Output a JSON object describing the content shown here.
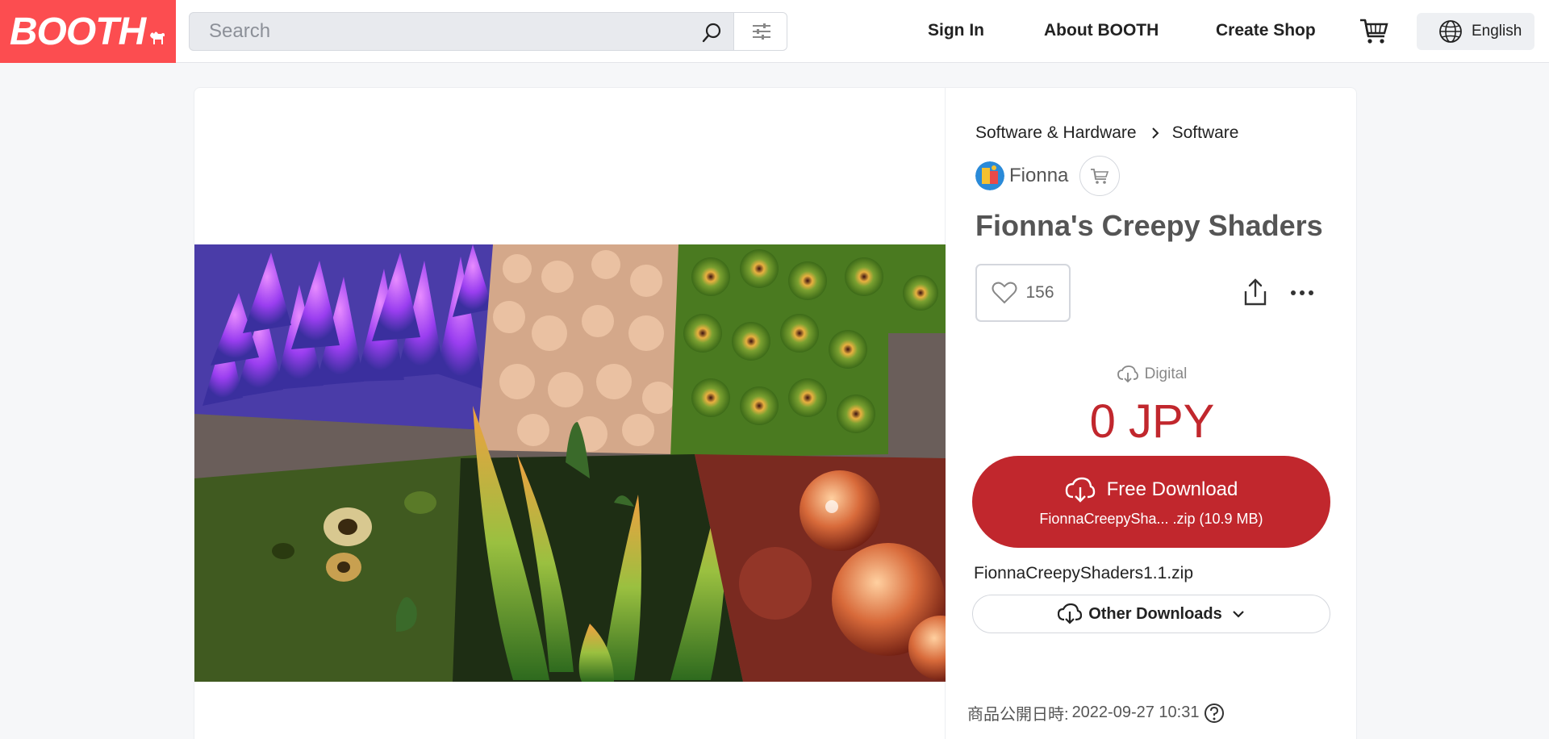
{
  "header": {
    "logo_text": "BOOTH",
    "search_placeholder": "Search",
    "nav": [
      "Sign In",
      "About BOOTH",
      "Create Shop"
    ],
    "language": "English"
  },
  "product": {
    "breadcrumb": [
      "Software & Hardware",
      "Software"
    ],
    "shop_name": "Fionna",
    "title": "Fionna's Creepy Shaders",
    "likes": "156",
    "type_label": "Digital",
    "price": "0 JPY",
    "download_label": "Free Download",
    "download_file": "FionnaCreepySha... .zip (10.9 MB)",
    "filename": "FionnaCreepyShaders1.1.zip",
    "other_downloads_label": "Other Downloads",
    "published_label": "商品公開日時:",
    "published_date": "2022-09-27 10:31"
  },
  "colors": {
    "brand": "#fc4d50",
    "price": "#c1272d"
  },
  "icons": [
    "search-icon",
    "filter-icon",
    "cart-icon",
    "globe-icon",
    "heart-icon",
    "share-icon",
    "more-icon",
    "cloud-download-icon",
    "chevron-down-icon",
    "help-icon"
  ]
}
